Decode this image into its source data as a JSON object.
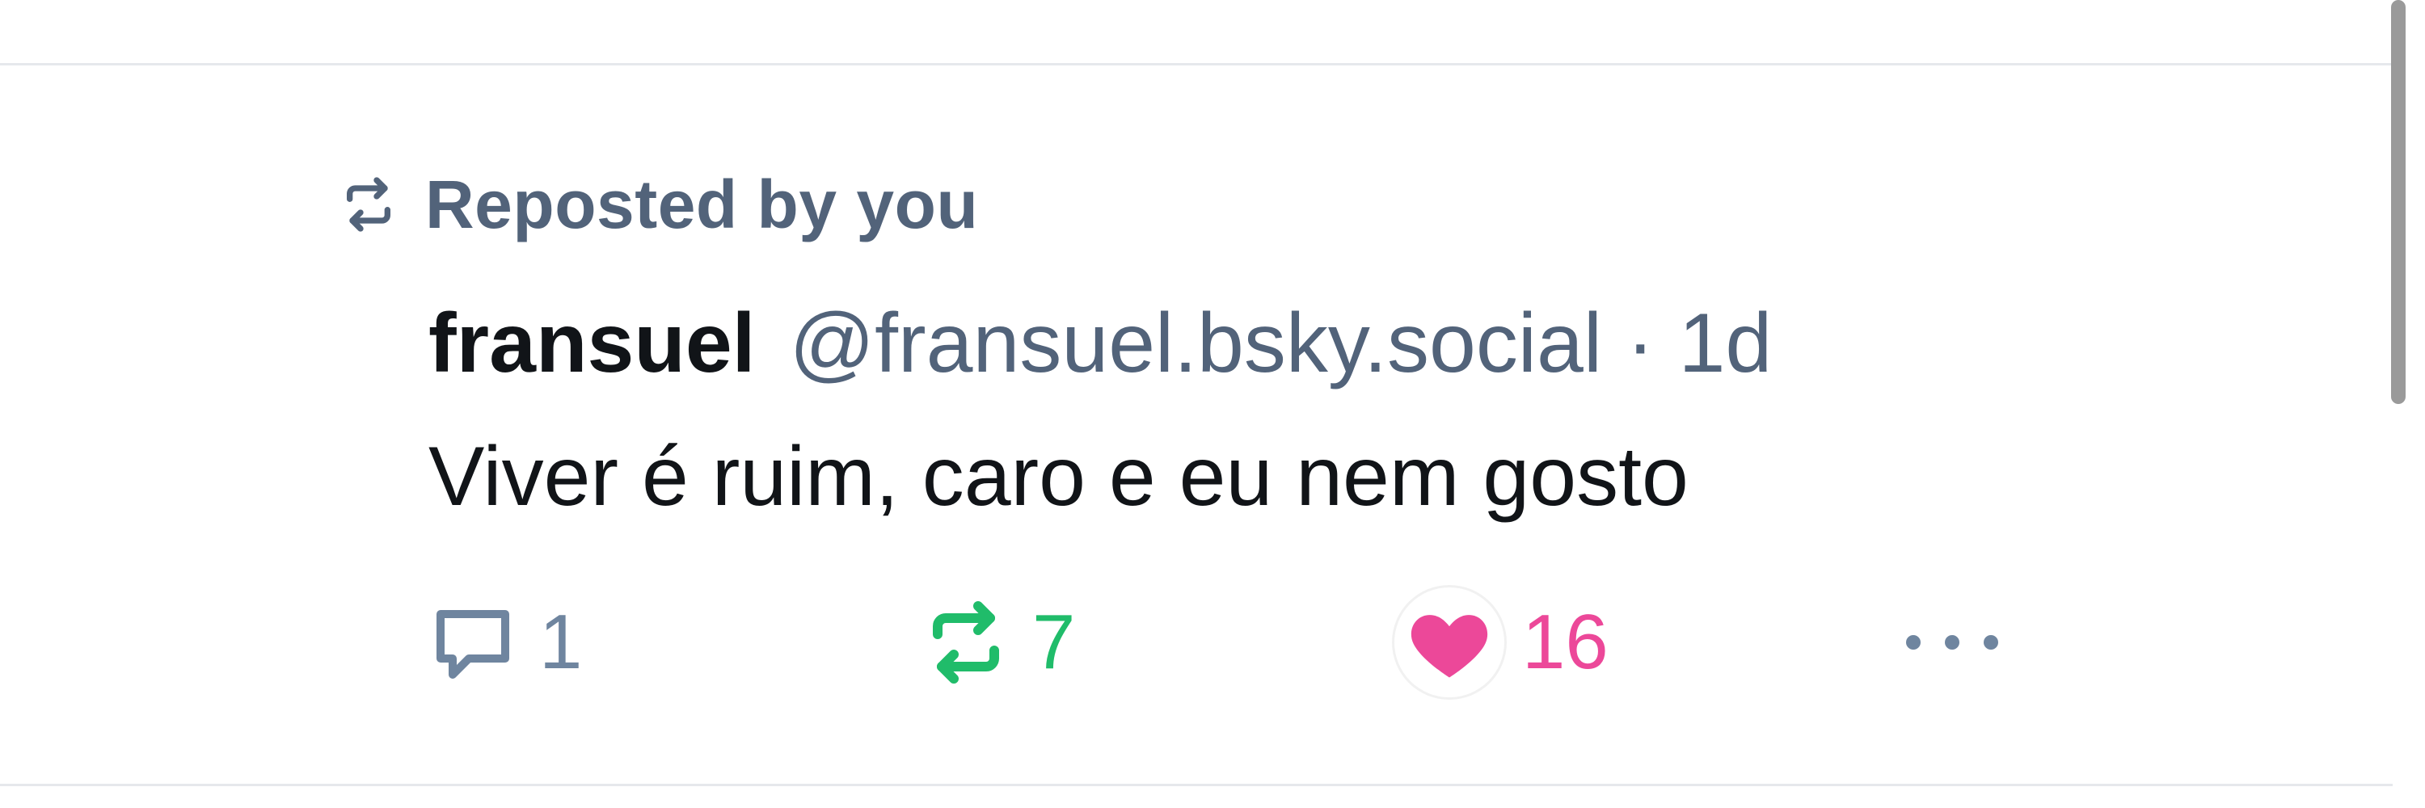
{
  "post": {
    "repost_label": "Reposted by you",
    "author_name": "fransuel",
    "author_handle": "@fransuel.bsky.social",
    "separator": "·",
    "age": "1d",
    "text": "Viver é ruim, caro e eu nem gosto"
  },
  "actions": {
    "reply_count": "1",
    "repost_count": "7",
    "like_count": "16"
  },
  "icons": {
    "repost_context": "repost-icon",
    "reply": "comment-icon",
    "repost": "repost-icon",
    "like": "heart-icon",
    "more": "more-icon"
  },
  "colors": {
    "muted": "#52637a",
    "reply": "#6f859f",
    "reposted": "#20bc6a",
    "liked": "#ec4899",
    "text": "#111418"
  }
}
